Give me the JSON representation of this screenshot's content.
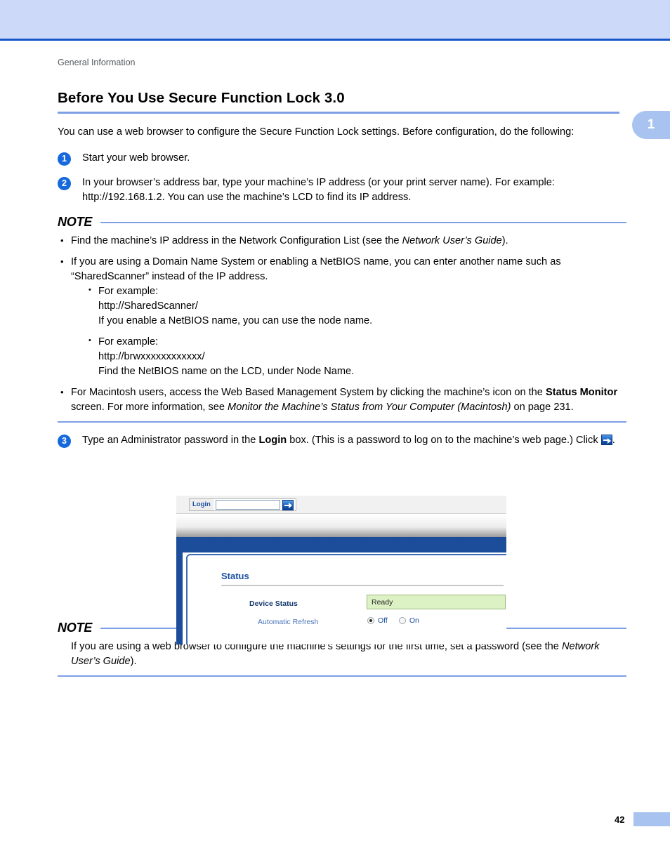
{
  "header": {
    "running_head": "General Information",
    "chapter_tab": "1",
    "band_color": "#ccd9f8",
    "rule_color": "#1656c8"
  },
  "section": {
    "title": "Before You Use Secure Function Lock 3.0",
    "intro": "You can use a web browser to configure the Secure Function Lock settings. Before configuration, do the following:"
  },
  "steps": [
    {
      "num": "1",
      "text": "Start your web browser."
    },
    {
      "num": "2",
      "text": "In your browser’s address bar, type your machine’s IP address (or your print server name). For example: http://192.168.1.2. You can use the machine’s LCD to find its IP address."
    },
    {
      "num": "3",
      "text_a": "Type an Administrator password in the ",
      "bold_login": "Login",
      "text_b": " box. (This is a password to log on to the machine’s web page.) Click ",
      "text_c": "."
    }
  ],
  "note_top": {
    "label": "NOTE",
    "bullets": [
      {
        "text_a": "Find the machine’s IP address in the Network Configuration List (see the ",
        "italic": "Network User’s Guide",
        "text_b": ")."
      },
      {
        "text_a": "If you are using a Domain Name System or enabling a NetBIOS name, you can enter another name such as “SharedScanner” instead of the IP address.",
        "italic": "",
        "text_b": ""
      }
    ],
    "sub_bullets": [
      {
        "line1": "For example:",
        "line2": "http://SharedScanner/",
        "line3": "If you enable a NetBIOS name, you can use the node name."
      },
      {
        "line1": "For example:",
        "line2": "http://brwxxxxxxxxxxxx/",
        "line3": "Find the NetBIOS name on the LCD, under Node Name."
      }
    ],
    "mac_bullet": {
      "text_a": "For Macintosh users, access the Web Based Management System by clicking the machine’s icon on the ",
      "bold": "Status Monitor",
      "text_b": " screen. For more information, see ",
      "italic": "Monitor the Machine’s Status from Your Computer (Macintosh)",
      "text_c": " on page 231."
    }
  },
  "screenshot": {
    "login_label": "Login",
    "login_value": "",
    "login_go_icon": "arrow-right-icon",
    "status_title": "Status",
    "device_status_label": "Device Status",
    "device_status_value": "Ready",
    "automatic_refresh_label": "Automatic Refresh",
    "radio_off_label": "Off",
    "radio_on_label": "On",
    "radio_selected": "Off",
    "ready_bg_color": "#ddf2c4",
    "navy_color": "#1c4d9b"
  },
  "note_bottom": {
    "label": "NOTE",
    "text_a": "If you are using a web browser to configure the machine’s settings for the first time, set a password (see the ",
    "italic": "Network User’s Guide",
    "text_b": ")."
  },
  "footer": {
    "page_number": "42"
  }
}
